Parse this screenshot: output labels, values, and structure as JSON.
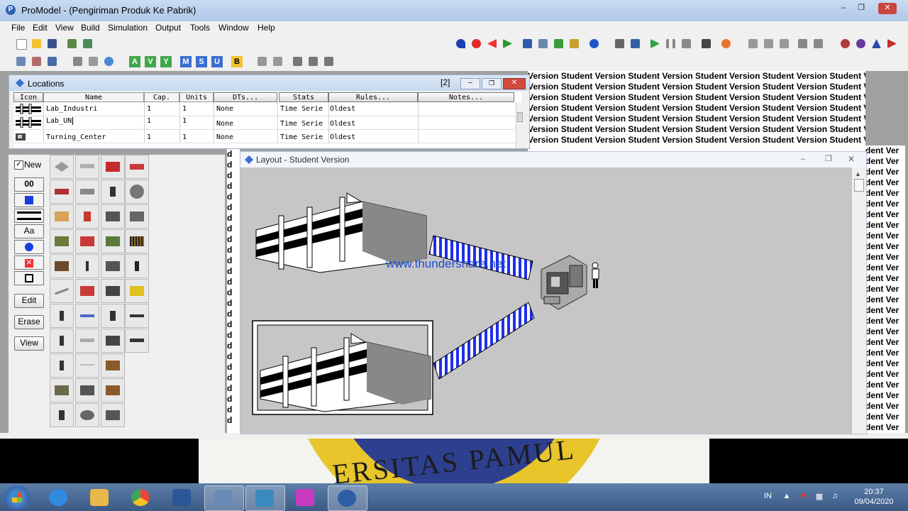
{
  "window": {
    "title": "ProModel - (Pengiriman Produk Ke Pabrik)",
    "controls": [
      "minimize",
      "maximize",
      "close"
    ]
  },
  "menubar": [
    "File",
    "Edit",
    "View",
    "Build",
    "Simulation",
    "Output",
    "Tools",
    "Window",
    "Help"
  ],
  "toolbar1_left_icons": [
    "new-icon",
    "open-icon",
    "save-icon",
    "print-icon",
    "print-preview-icon"
  ],
  "toolbar1_right_icons": [
    "model-check-icon",
    "stop-icon",
    "back-icon",
    "forward-icon",
    "run-icon",
    "layout-icon",
    "background-icon",
    "path-icon",
    "info-icon",
    "options-icon",
    "window-icon",
    "play-icon",
    "pause-icon",
    "step-icon",
    "grid-icon",
    "palette-icon"
  ],
  "toolbar2_labels": [
    "A",
    "V",
    "Y",
    "M",
    "S",
    "U",
    "B"
  ],
  "locations": {
    "title": "Locations",
    "count_badge": "[2]",
    "headers": {
      "icon": "Icon",
      "name": "Name",
      "cap": "Cap.",
      "units": "Units",
      "dts": "DTs...",
      "stats": "Stats",
      "rules": "Rules...",
      "notes": "Notes..."
    },
    "rows": [
      {
        "name": "Lab_Industri",
        "cap": "1",
        "units": "1",
        "dts": "None",
        "stats": "Time Serie",
        "rules": "Oldest",
        "notes": ""
      },
      {
        "name": "Lab_UN",
        "cap": "1",
        "units": "1",
        "dts": "None",
        "stats": "Time Serie",
        "rules": "Oldest",
        "notes": ""
      },
      {
        "name": "Turning_Center",
        "cap": "1",
        "units": "1",
        "dts": "None",
        "stats": "Time Serie",
        "rules": "Oldest",
        "notes": ""
      }
    ]
  },
  "graphics": {
    "new_label": "New",
    "side_buttons": [
      "00",
      "Aa"
    ],
    "edit_label": "Edit",
    "erase_label": "Erase",
    "view_label": "View"
  },
  "layout": {
    "title": "Layout - Student Version",
    "watermark": "www.thundershare.net"
  },
  "student_text": "Version Student Version Student Version Student Version Student Version Student Version",
  "student_right": "dent Ver",
  "student_left": "d",
  "taskbar": {
    "language": "IN",
    "time": "20:37",
    "date": "09/04/2020"
  },
  "background": {
    "logo_text": "ERSITAS PAMUL"
  },
  "colors": {
    "conveyor_blue": "#1f2fe8",
    "title_bar": "#c9dcf1",
    "taskbar": "#4a6c98"
  }
}
